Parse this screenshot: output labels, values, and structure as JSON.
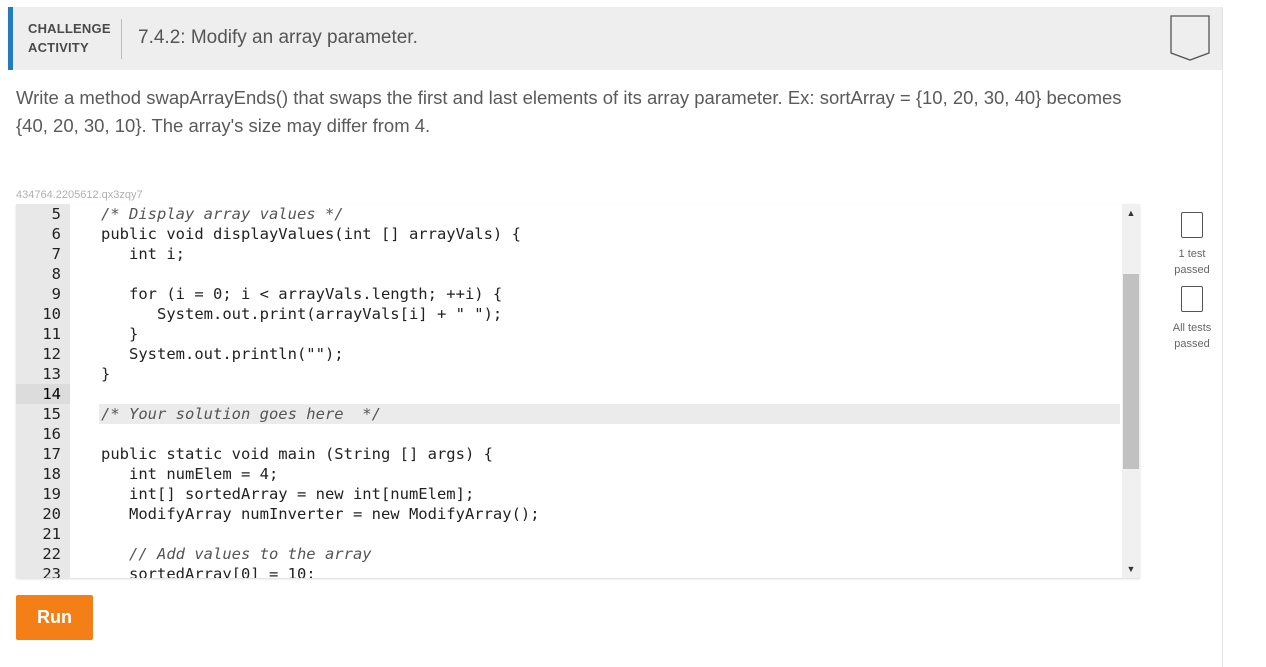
{
  "header": {
    "activity_type": "CHALLENGE\nACTIVITY",
    "title": "7.4.2: Modify an array parameter."
  },
  "prompt": "Write a method swapArrayEnds() that swaps the first and last elements of its array parameter. Ex: sortArray = {10, 20, 30, 40} becomes {40, 20, 30, 10}. The array's size may differ from 4.",
  "activity_id": "434764.2205612.qx3zqy7",
  "editor": {
    "lines": [
      {
        "n": "5",
        "code": "/* Display array values */"
      },
      {
        "n": "6",
        "code": "public void displayValues(int [] arrayVals) {"
      },
      {
        "n": "7",
        "code": "   int i;"
      },
      {
        "n": "8",
        "code": ""
      },
      {
        "n": "9",
        "code": "   for (i = 0; i < arrayVals.length; ++i) {"
      },
      {
        "n": "10",
        "code": "      System.out.print(arrayVals[i] + \" \");"
      },
      {
        "n": "11",
        "code": "   }"
      },
      {
        "n": "12",
        "code": "   System.out.println(\"\");"
      },
      {
        "n": "13",
        "code": "}"
      },
      {
        "n": "14",
        "code": ""
      },
      {
        "n": "15",
        "code": "/* Your solution goes here  */"
      },
      {
        "n": "16",
        "code": ""
      },
      {
        "n": "17",
        "code": "public static void main (String [] args) {"
      },
      {
        "n": "18",
        "code": "   int numElem = 4;"
      },
      {
        "n": "19",
        "code": "   int[] sortedArray = new int[numElem];"
      },
      {
        "n": "20",
        "code": "   ModifyArray numInverter = new ModifyArray();"
      },
      {
        "n": "21",
        "code": ""
      },
      {
        "n": "22",
        "code": "   // Add values to the array"
      },
      {
        "n": "23",
        "code": "   sortedArray[0] = 10;"
      }
    ],
    "highlight_line": "15"
  },
  "tests": [
    {
      "label": "1 test passed"
    },
    {
      "label": "All tests passed"
    }
  ],
  "run_label": "Run",
  "colors": {
    "accent": "#1f7cc1",
    "run_button": "#f57f17"
  }
}
